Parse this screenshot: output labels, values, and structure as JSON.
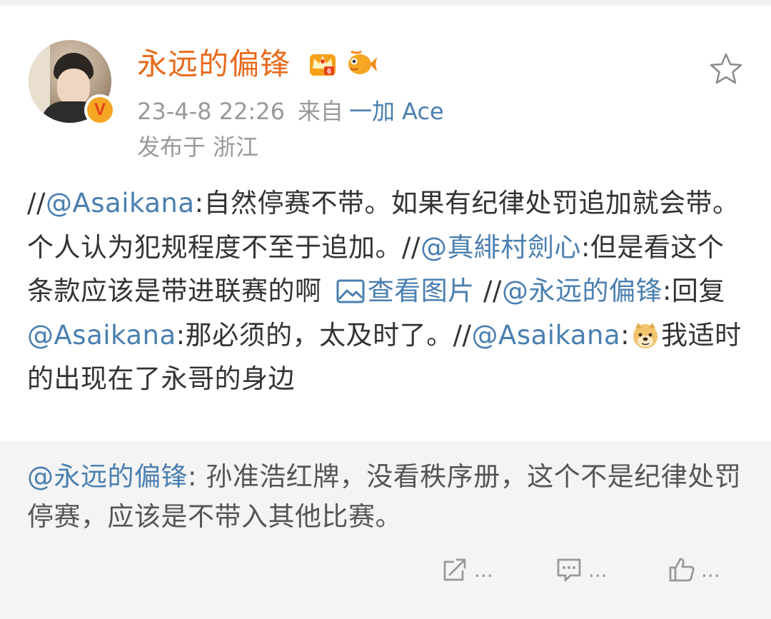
{
  "post": {
    "author": "永远的偏锋",
    "time": "23-4-8 22:26",
    "source_prefix": "来自",
    "device": "一加 Ace",
    "location": "发布于 浙江",
    "badge_letter": "V",
    "content": {
      "p1": "//",
      "m1": "@Asaikana",
      "t1": ":自然停赛不带。如果有纪律处罚追加就会带。个人认为犯规程度不至于追加。//",
      "m2": "@真緋村劍心",
      "t2": ":但是看这个条款应该是带进联赛的啊 ",
      "view_image": "查看图片",
      "t3": " //",
      "m3": "@永远的偏锋",
      "t4": ":回复",
      "m4": "@Asaikana",
      "t5": ":那必须的，太及时了。//",
      "m5": "@Asaikana",
      "t6": ":",
      "t7": "我适时的出现在了永哥的身边"
    }
  },
  "original": {
    "mention": "@永远的偏锋",
    "text": ": 孙准浩红牌，没看秩序册，这个不是纪律处罚停赛，应该是不带入其他比赛。",
    "actions": {
      "repost_label": "...",
      "comment_label": "...",
      "like_label": "..."
    }
  },
  "icons": {
    "star": "star-outline-icon",
    "crown": "crown-badge-icon",
    "fish": "fish-badge-icon",
    "image": "image-icon",
    "doge": "doge-emoji-icon",
    "repost": "repost-icon",
    "comment": "comment-icon",
    "like": "like-icon"
  },
  "colors": {
    "username": "#e86b1b",
    "link": "#4a7fb0",
    "meta": "#999999",
    "original_bg": "#f4f4f4"
  }
}
